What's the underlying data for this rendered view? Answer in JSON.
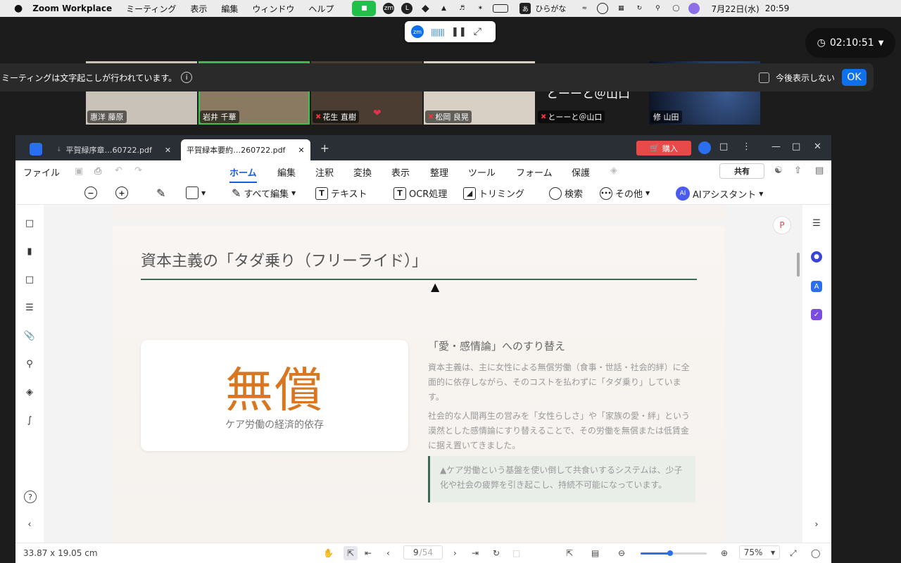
{
  "menubar": {
    "app": "Zoom Workplace",
    "items": [
      "ミーティング",
      "表示",
      "編集",
      "ウィンドウ",
      "ヘルプ"
    ],
    "ime": "あ",
    "ime_label": "ひらがな",
    "date": "7月22日(水)",
    "time": "20:59"
  },
  "timer": "02:10:51",
  "notice": {
    "text": "ミーティングは文字起こしが行われています。",
    "checkbox_label": "今後表示しない",
    "ok": "OK"
  },
  "participants": [
    {
      "name": "惠洋 藤原",
      "muted": false
    },
    {
      "name": "岩井 千華",
      "muted": false
    },
    {
      "name": "花生 直樹",
      "muted": true
    },
    {
      "name": "松岡 良晃",
      "muted": true
    },
    {
      "name": "とーーと＠山口",
      "muted": true
    },
    {
      "name": "修 山田",
      "muted": false
    }
  ],
  "participant_overlay_text": "とーーと＠山口",
  "pdf": {
    "tabs": [
      "平賀緑序章…60722.pdf",
      "平賀緑本要約…260722.pdf"
    ],
    "buy": "購入",
    "file_menu": "ファイル",
    "menu_tabs": [
      "ホーム",
      "編集",
      "注釈",
      "変換",
      "表示",
      "整理",
      "ツール",
      "フォーム",
      "保護"
    ],
    "share": "共有",
    "tools": {
      "edit_all": "すべて編集",
      "text": "テキスト",
      "ocr": "OCR処理",
      "trim": "トリミング",
      "search": "検索",
      "more": "その他",
      "ai": "AIアシスタント"
    },
    "page": {
      "title": "資本主義の「タダ乗り（フリーライド）」",
      "card_big": "無償",
      "card_sub": "ケア労働の経済的依存",
      "heading": "「愛・感情論」へのすり替え",
      "para1": "資本主義は、主に女性による無償労働（食事・世話・社会的絆）に全面的に依存しながら、そのコストを払わずに「タダ乗り」しています。",
      "para2": "社会的な人間再生の営みを「女性らしさ」や「家族の愛・絆」という漠然とした感情論にすり替えることで、その労働を無償または低賃金に据え置いてきました。",
      "callout": "▲ケア労働という基盤を使い倒して共食いするシステムは、少子化や社会の疲弊を引き起こし、持続不可能になっています。"
    },
    "status": {
      "size": "33.87 x 19.05 cm",
      "page_current": "9",
      "page_total": "/54",
      "zoom": "75%",
      "zoom_level": 0.45
    }
  }
}
